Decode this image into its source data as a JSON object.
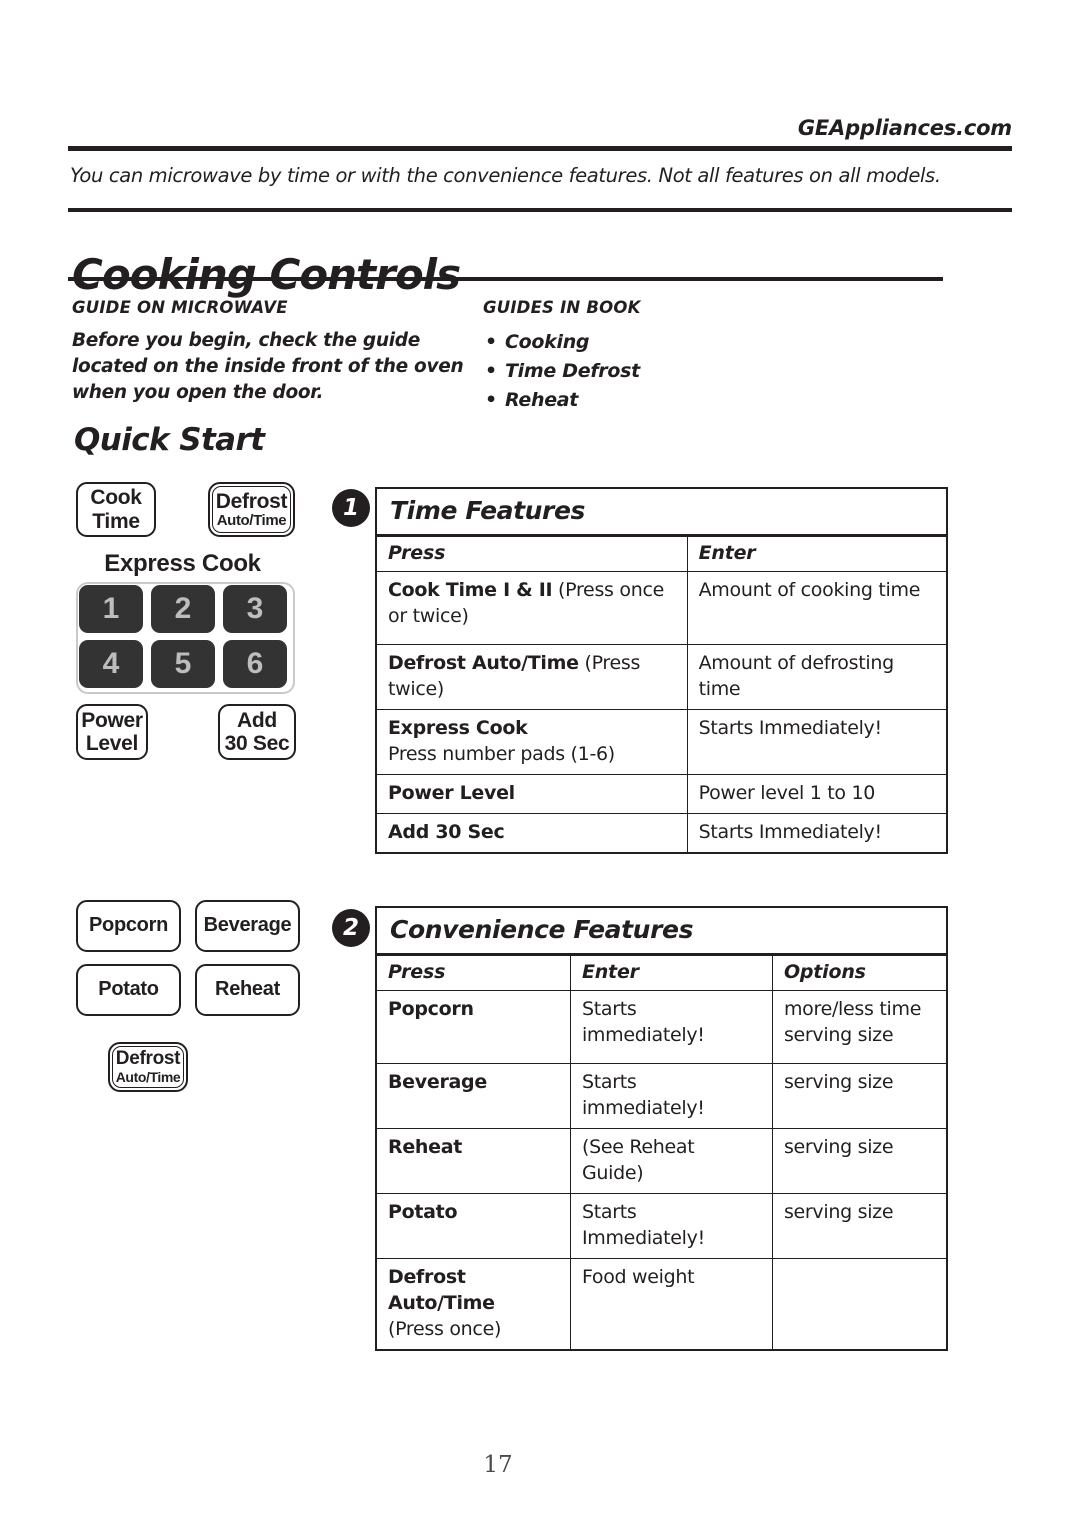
{
  "header": {
    "site_url": "GEAppliances.com",
    "intro": "You can microwave by time or with the convenience features.  Not all features on all models."
  },
  "page_title": "Cooking Controls",
  "guides": {
    "left_heading": "GUIDE ON MICROWAVE",
    "left_body": "Before you begin, check the guide located on the inside front of the oven when you open the door.",
    "right_heading": "GUIDES IN BOOK",
    "right_items": [
      "Cooking",
      "Time Defrost",
      "Reheat"
    ]
  },
  "section_title": "Quick Start",
  "keypad1": {
    "cook_time_line1": "Cook",
    "cook_time_line2": "Time",
    "defrost_line1": "Defrost",
    "defrost_line2": "Auto/Time",
    "express_cook_label": "Express Cook",
    "number_pads": [
      "1",
      "2",
      "3",
      "4",
      "5",
      "6"
    ],
    "power_level_line1": "Power",
    "power_level_line2": "Level",
    "add30_line1": "Add",
    "add30_line2": "30 Sec"
  },
  "keypad2": {
    "popcorn": "Popcorn",
    "beverage": "Beverage",
    "potato": "Potato",
    "reheat": "Reheat",
    "defrost_line1": "Defrost",
    "defrost_line2": "Auto/Time"
  },
  "badges": {
    "one": "1",
    "two": "2"
  },
  "time_features": {
    "title": "Time Features",
    "columns": [
      "Press",
      "Enter"
    ],
    "rows": [
      {
        "press_bold": "Cook Time I & II",
        "press_rest": " (Press once or twice)",
        "enter": "Amount of cooking time"
      },
      {
        "press_bold": "Defrost Auto/Time",
        "press_rest": " (Press twice)",
        "enter": "Amount of defrosting time"
      },
      {
        "press_bold": "Express Cook",
        "press_rest": "Press number pads (1-6)",
        "enter": "Starts Immediately!"
      },
      {
        "press_bold": "Power Level",
        "press_rest": "",
        "enter": "Power level 1 to 10"
      },
      {
        "press_bold": "Add 30 Sec",
        "press_rest": "",
        "enter": "Starts Immediately!"
      }
    ]
  },
  "convenience_features": {
    "title": "Convenience Features",
    "columns": [
      "Press",
      "Enter",
      "Options"
    ],
    "rows": [
      {
        "press_bold": "Popcorn",
        "press_rest": "",
        "enter": "Starts immediately!",
        "options": "more/less time serving size"
      },
      {
        "press_bold": "Beverage",
        "press_rest": "",
        "enter": "Starts immediately!",
        "options": "serving size"
      },
      {
        "press_bold": "Reheat",
        "press_rest": "",
        "enter": "(See Reheat Guide)",
        "options": "serving size"
      },
      {
        "press_bold": "Potato",
        "press_rest": "",
        "enter": "Starts Immediately!",
        "options": "serving size"
      },
      {
        "press_bold": "Defrost Auto/Time",
        "press_rest": "(Press once)",
        "enter": "Food weight",
        "options": ""
      }
    ]
  },
  "footer": {
    "page_number": "17"
  }
}
